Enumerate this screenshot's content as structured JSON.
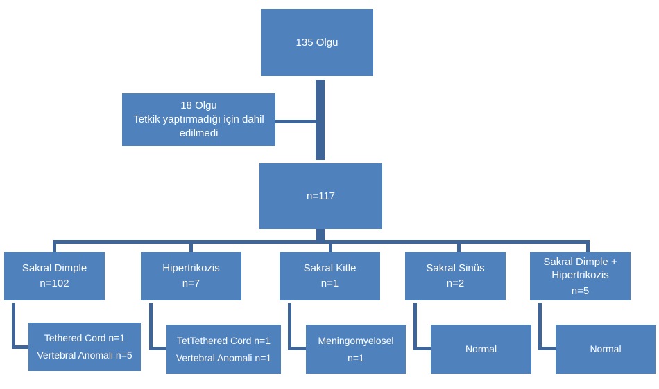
{
  "colors": {
    "box": "#4f81bd",
    "connector": "#3f6598",
    "text": "#ffffff"
  },
  "root": {
    "label": "135 Olgu"
  },
  "excluded": {
    "line1": "18 Olgu",
    "line2": "Tetkik yaptırmadığı için dahil edilmedi"
  },
  "included": {
    "label": "n=117"
  },
  "groups": [
    {
      "name": "Sakral  Dimple",
      "count": "n=102",
      "result": [
        "Tethered Cord n=1",
        "Vertebral Anomali n=5"
      ]
    },
    {
      "name": "Hipertrikozis",
      "count": "n=7",
      "result": [
        "TetTethered Cord n=1",
        "Vertebral Anomali n=1"
      ]
    },
    {
      "name": "Sakral  Kitle",
      "count": "n=1",
      "result": [
        "Meningomyelosel",
        "n=1"
      ]
    },
    {
      "name": "Sakral  Sinüs",
      "count": "n=2",
      "result": [
        "Normal"
      ]
    },
    {
      "name": "Sakral Dimple + Hipertrikozis",
      "count": "n=5",
      "result": [
        "Normal"
      ]
    }
  ]
}
